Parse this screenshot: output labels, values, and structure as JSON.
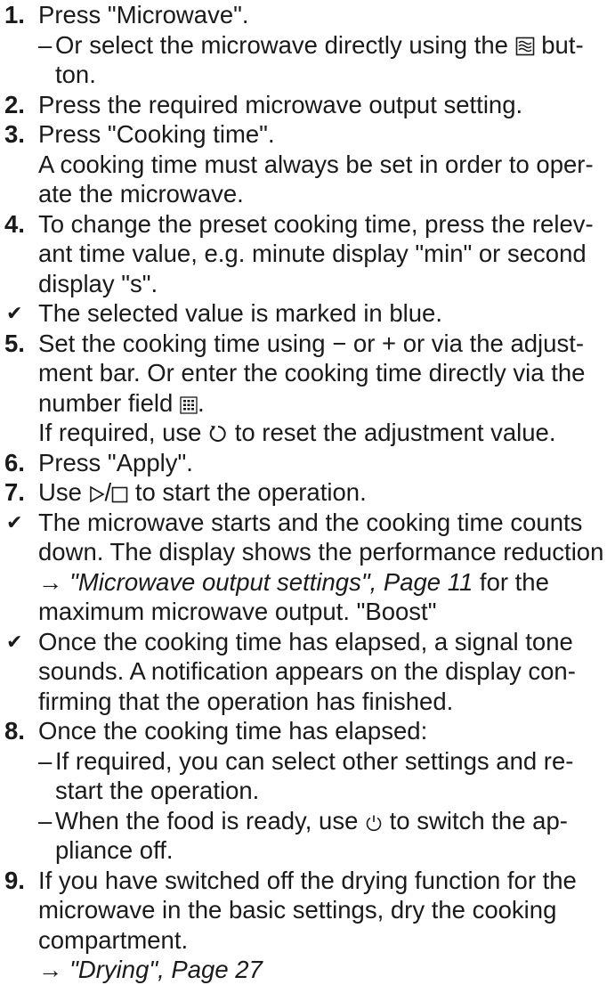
{
  "steps": [
    {
      "number": "1.",
      "text": "Press \"Microwave\"."
    },
    {
      "number": "2.",
      "text": "Press the required microwave output setting."
    },
    {
      "number": "3.",
      "text": "Press \"Cooking time\".",
      "note": "A cooking time must always be set in order to oper-ate the microwave."
    },
    {
      "number": "4.",
      "line1": "To change the preset cooking time, press the relev-",
      "line2": "ant time value, e.g. minute display \"min\" or second",
      "line3": "display \"s\"."
    },
    {
      "number": "5.",
      "line1_a": "Set the cooking time using ",
      "line1_b": " or ",
      "line1_c": " or via the adjust-",
      "line2": "ment bar. Or enter the cooking time directly via the",
      "line3": "number field ",
      "line3_end": ".",
      "note_a": "If required, use ",
      "note_b": " to reset the adjustment value."
    },
    {
      "number": "6.",
      "text": "Press \"Apply\"."
    },
    {
      "number": "7.",
      "text_a": "Use ",
      "text_sep": "/",
      "text_b": " to start the operation."
    },
    {
      "number": "8.",
      "text": "Once the cooking time has elapsed:"
    },
    {
      "number": "9.",
      "line1": "If you have switched off the drying function for the",
      "line2": "microwave in the basic settings, dry the cooking",
      "line3": "compartment.",
      "ref": "→ \"Drying\", Page 27"
    }
  ],
  "step1_sub": {
    "text_a": "Or select the microwave directly using the ",
    "text_b": " but-",
    "text_c": "ton."
  },
  "results": {
    "r1": "The selected value is marked in blue.",
    "r2_l1": "The microwave starts and the cooking time counts",
    "r2_l2": "down. The display shows the performance reduction",
    "r2_ref": "→ \"Microwave output settings\", Page 11",
    "r2_l3_end": " for the",
    "r2_l4": "maximum microwave output. \"Boost\"",
    "r3_l1": "Once the cooking time has elapsed, a signal tone",
    "r3_l2": "sounds. A notification appears on the display con-",
    "r3_l3": "firming that the operation has finished."
  },
  "step8_subs": [
    {
      "l1": "If required, you can select other settings and re-",
      "l2": "start the operation."
    },
    {
      "l1_a": "When the food is ready, use ",
      "l1_b": " to switch the ap-",
      "l2": "pliance off."
    }
  ],
  "symbols": {
    "dash": "–",
    "check": "✔",
    "minus": "−",
    "plus": "+"
  }
}
